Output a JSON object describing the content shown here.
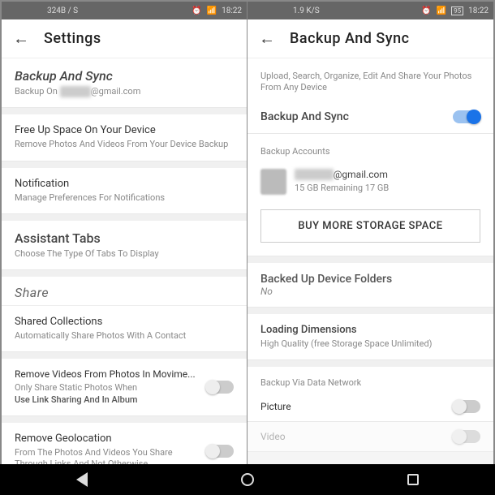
{
  "left": {
    "status": {
      "data": "324B / S",
      "time": "18:22"
    },
    "header": {
      "title": "Settings"
    },
    "backup": {
      "title": "Backup And Sync",
      "sub_prefix": "Backup On",
      "sub_suffix": "@gmail.com"
    },
    "freeup": {
      "title": "Free Up Space On Your Device",
      "sub": "Remove Photos And Videos From Your Device Backup"
    },
    "notif": {
      "title": "Notification",
      "sub": "Manage Preferences For Notifications"
    },
    "assist": {
      "title": "Assistant Tabs",
      "sub": "Choose The Type Of Tabs To Display"
    },
    "share_header": "Share",
    "shared": {
      "title": "Shared Collections",
      "sub": "Automatically Share Photos With A Contact"
    },
    "remvid": {
      "title": "Remove Videos From Photos In Movime...",
      "sub1": "Only Share Static Photos When",
      "sub2": "Use Link Sharing And In Album"
    },
    "remgeo": {
      "title": "Remove Geolocation",
      "sub": "From The Photos And Videos You Share Through Links And Not Otherwise"
    }
  },
  "right": {
    "status": {
      "data": "1.9 K/S",
      "batt": "95",
      "time": "18:22"
    },
    "header": {
      "title": "Backup And Sync"
    },
    "desc": "Upload, Search, Organize, Edit And Share Your Photos From Any Device",
    "toggle_label": "Backup And Sync",
    "accounts_label": "Backup Accounts",
    "account": {
      "email_suffix": "@gmail.com",
      "storage": "15 GB Remaining 17 GB"
    },
    "buy_btn": "BUY MORE STORAGE SPACE",
    "folders": {
      "title": "Backed Up Device Folders",
      "sub": "No"
    },
    "loading": {
      "title": "Loading Dimensions",
      "sub": "High Quality (free Storage Space Unlimited)"
    },
    "network_label": "Backup Via Data Network",
    "picture_label": "Picture",
    "video_label": "Video"
  }
}
